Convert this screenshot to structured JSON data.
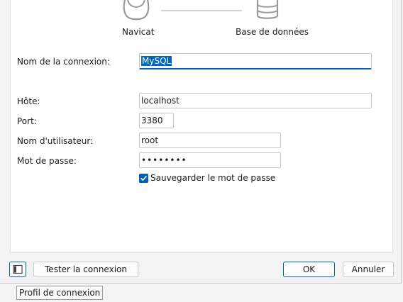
{
  "header": {
    "left_icon": "navicat-icon",
    "left_label": "Navicat",
    "right_icon": "database-icon",
    "right_label": "Base de données"
  },
  "form": {
    "connection_name": {
      "label": "Nom de la connexion:",
      "value": "MySQL"
    },
    "host": {
      "label": "Hôte:",
      "value": "localhost"
    },
    "port": {
      "label": "Port:",
      "value": "3380"
    },
    "username": {
      "label": "Nom d'utilisateur:",
      "value": "root"
    },
    "password": {
      "label": "Mot de passe:",
      "value": "••••••••"
    },
    "save_password": {
      "label": "Sauvegarder le mot de passe",
      "checked": true
    }
  },
  "footer": {
    "profile_icon": "panel-toggle-icon",
    "test_button": "Tester la connexion",
    "ok_button": "OK",
    "cancel_button": "Annuler",
    "tooltip": "Profil de connexion"
  },
  "colors": {
    "accent": "#005fb8",
    "selection": "#0067c0"
  }
}
